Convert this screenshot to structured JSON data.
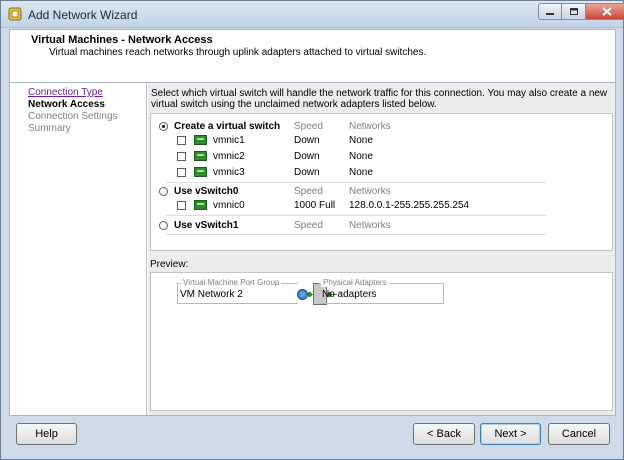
{
  "window": {
    "title": "Add Network Wizard"
  },
  "header": {
    "title": "Virtual Machines - Network Access",
    "subtitle": "Virtual machines reach networks through uplink adapters attached to virtual switches."
  },
  "nav": {
    "items": [
      {
        "label": "Connection Type",
        "state": "link"
      },
      {
        "label": "Network Access",
        "state": "current"
      },
      {
        "label": "Connection Settings",
        "state": "pending"
      },
      {
        "label": "Summary",
        "state": "pending"
      }
    ]
  },
  "main": {
    "instructions": "Select which virtual switch will handle the network traffic for this connection. You may also create a new virtual switch using the unclaimed network adapters listed below.",
    "switches": [
      {
        "label": "Create a virtual switch",
        "selected": true,
        "speed_header": "Speed",
        "networks_header": "Networks",
        "adapters": [
          {
            "name": "vmnic1",
            "speed": "Down",
            "networks": "None",
            "checked": false
          },
          {
            "name": "vmnic2",
            "speed": "Down",
            "networks": "None",
            "checked": false
          },
          {
            "name": "vmnic3",
            "speed": "Down",
            "networks": "None",
            "checked": false
          }
        ]
      },
      {
        "label": "Use vSwitch0",
        "selected": false,
        "speed_header": "Speed",
        "networks_header": "Networks",
        "adapters": [
          {
            "name": "vmnic0",
            "speed": "1000 Full",
            "networks": "128.0.0.1-255.255.255.254",
            "checked": false
          }
        ]
      },
      {
        "label": "Use vSwitch1",
        "selected": false,
        "speed_header": "Speed",
        "networks_header": "Networks",
        "adapters": []
      }
    ]
  },
  "preview": {
    "label": "Preview:",
    "port_group_legend": "Virtual Machine Port Group",
    "port_group_name": "VM Network 2",
    "physical_legend": "Physical Adapters",
    "physical_text": "No adapters"
  },
  "buttons": {
    "help": "Help",
    "back": "< Back",
    "next": "Next >",
    "cancel": "Cancel"
  },
  "colors": {
    "titlebar": "#cfdbe8",
    "close_button": "#c9473a",
    "nic_green": "#2e8b2e",
    "link_visited": "#6a1e99"
  }
}
